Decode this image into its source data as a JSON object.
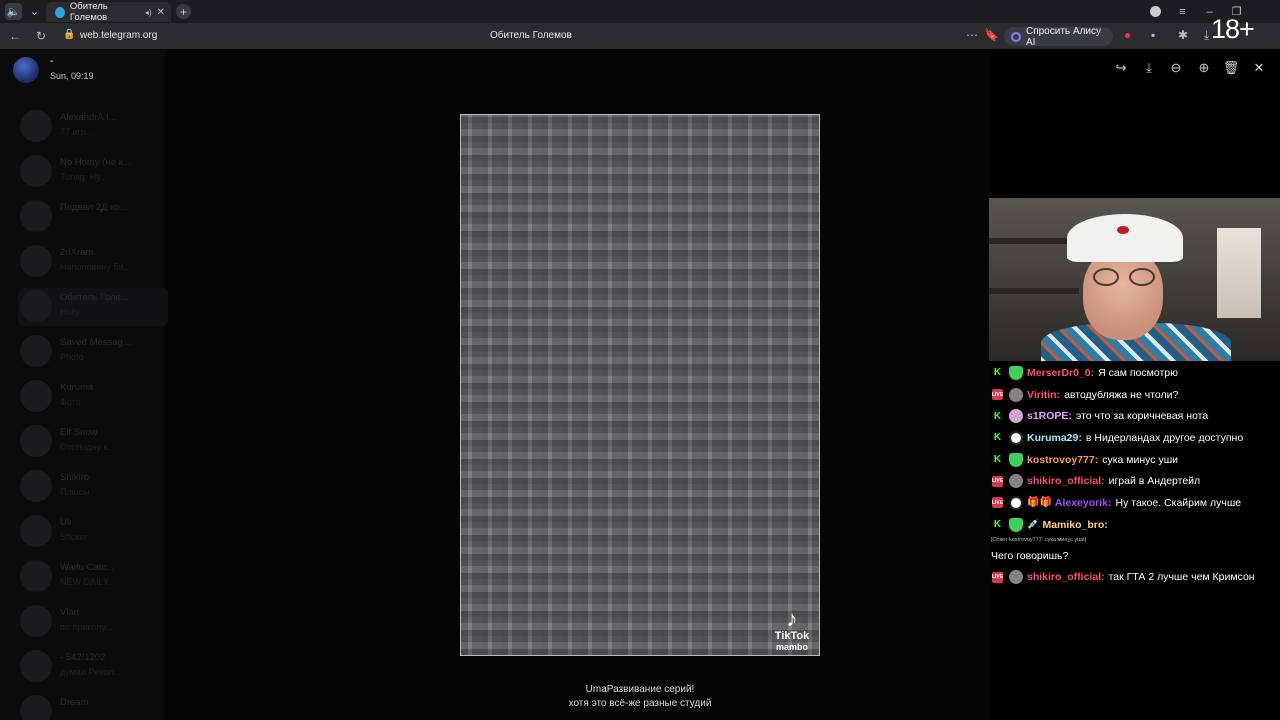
{
  "browser": {
    "tab_title": "Обитель Големов",
    "url": "web.telegram.org",
    "page_title": "Обитель Големов",
    "alisa_label": "Спросить Алису AI"
  },
  "viewer": {
    "sender_name": "-",
    "timestamp": "Sun, 09:19"
  },
  "sidebar": {
    "chats": [
      {
        "name": "AlexandrA I...",
        "preview": "77 игр..."
      },
      {
        "name": "No Homy (не к...",
        "preview": "Turvig: Ну..."
      },
      {
        "name": "Подвал 2Д ко...",
        "preview": ""
      },
      {
        "name": "2dXram",
        "preview": "Наполовину би..."
      },
      {
        "name": "Обитель Голе...",
        "preview": "Holly"
      },
      {
        "name": "Saved Messag...",
        "preview": "Photo"
      },
      {
        "name": "Kuruma",
        "preview": "Фото"
      },
      {
        "name": "Elf Snow",
        "preview": "Отстыдну к..."
      },
      {
        "name": "Shikiro",
        "preview": "Плюсы"
      },
      {
        "name": "Uli",
        "preview": "Sticker"
      },
      {
        "name": "Waifu Catc...",
        "preview": "NEW DAILY..."
      },
      {
        "name": "Vlad",
        "preview": "по приколу..."
      },
      {
        "name": "- 542/1202",
        "preview": "думал Рекол..."
      },
      {
        "name": "Dream",
        "preview": ""
      }
    ]
  },
  "video": {
    "brand": "TikTok",
    "username": "mambo"
  },
  "caption": {
    "line1": "UmaРазвивание серий!",
    "line2": "хотя это всё-же разные студий"
  },
  "stream": {
    "rating": "18+",
    "chat": [
      {
        "platform": "kick",
        "badge": "gem",
        "nick": "MerserDr0_0:",
        "color": "#ff4d6d",
        "text": "Я сам посмотрю"
      },
      {
        "platform": "vk",
        "badge": "gray",
        "nick": "Viritin:",
        "color": "#ff4d6d",
        "text": "автодубляжа не чтоли?"
      },
      {
        "platform": "kick",
        "badge": "pink",
        "nick": "s1ROPE:",
        "color": "#e8a0ff",
        "text": "это что за коричневая нота"
      },
      {
        "platform": "kick",
        "badge": "white",
        "nick": "Kuruma29:",
        "color": "#9ef0ff",
        "text": "в Нидерландах другое доступно"
      },
      {
        "platform": "kick",
        "badge": "gem",
        "nick": "kostrovoy777:",
        "color": "#ff9b3d",
        "text": "сука минус уши"
      },
      {
        "platform": "vk",
        "badge": "gray",
        "nick": "shikiro_official:",
        "color": "#ff4d6d",
        "text": "играй в Андертейл"
      },
      {
        "platform": "vk",
        "badge": "white",
        "extra": "🎁🎁",
        "nick": "Alexeyorik:",
        "color": "#a44dff",
        "text": "Ну такое. Скайрим лучше"
      },
      {
        "platform": "kick",
        "badge": "gem",
        "extra": "💉",
        "nick": "Mamiko_bro:",
        "color": "#ffd27a",
        "text": ""
      },
      {
        "platform": "vk",
        "badge": "gray",
        "nick": "shikiro_official:",
        "color": "#ff4d6d",
        "text": "так ГТА 2 лучше чем Кримсон"
      }
    ],
    "reply_ref": "[Ответ kostrovoy777: сука минус уши]",
    "reply_text": "Чего говоришь?"
  },
  "colors": {
    "accent_tg": "#2aa3e0",
    "kick_green": "#53fc18",
    "vk_red": "#e0344b"
  }
}
